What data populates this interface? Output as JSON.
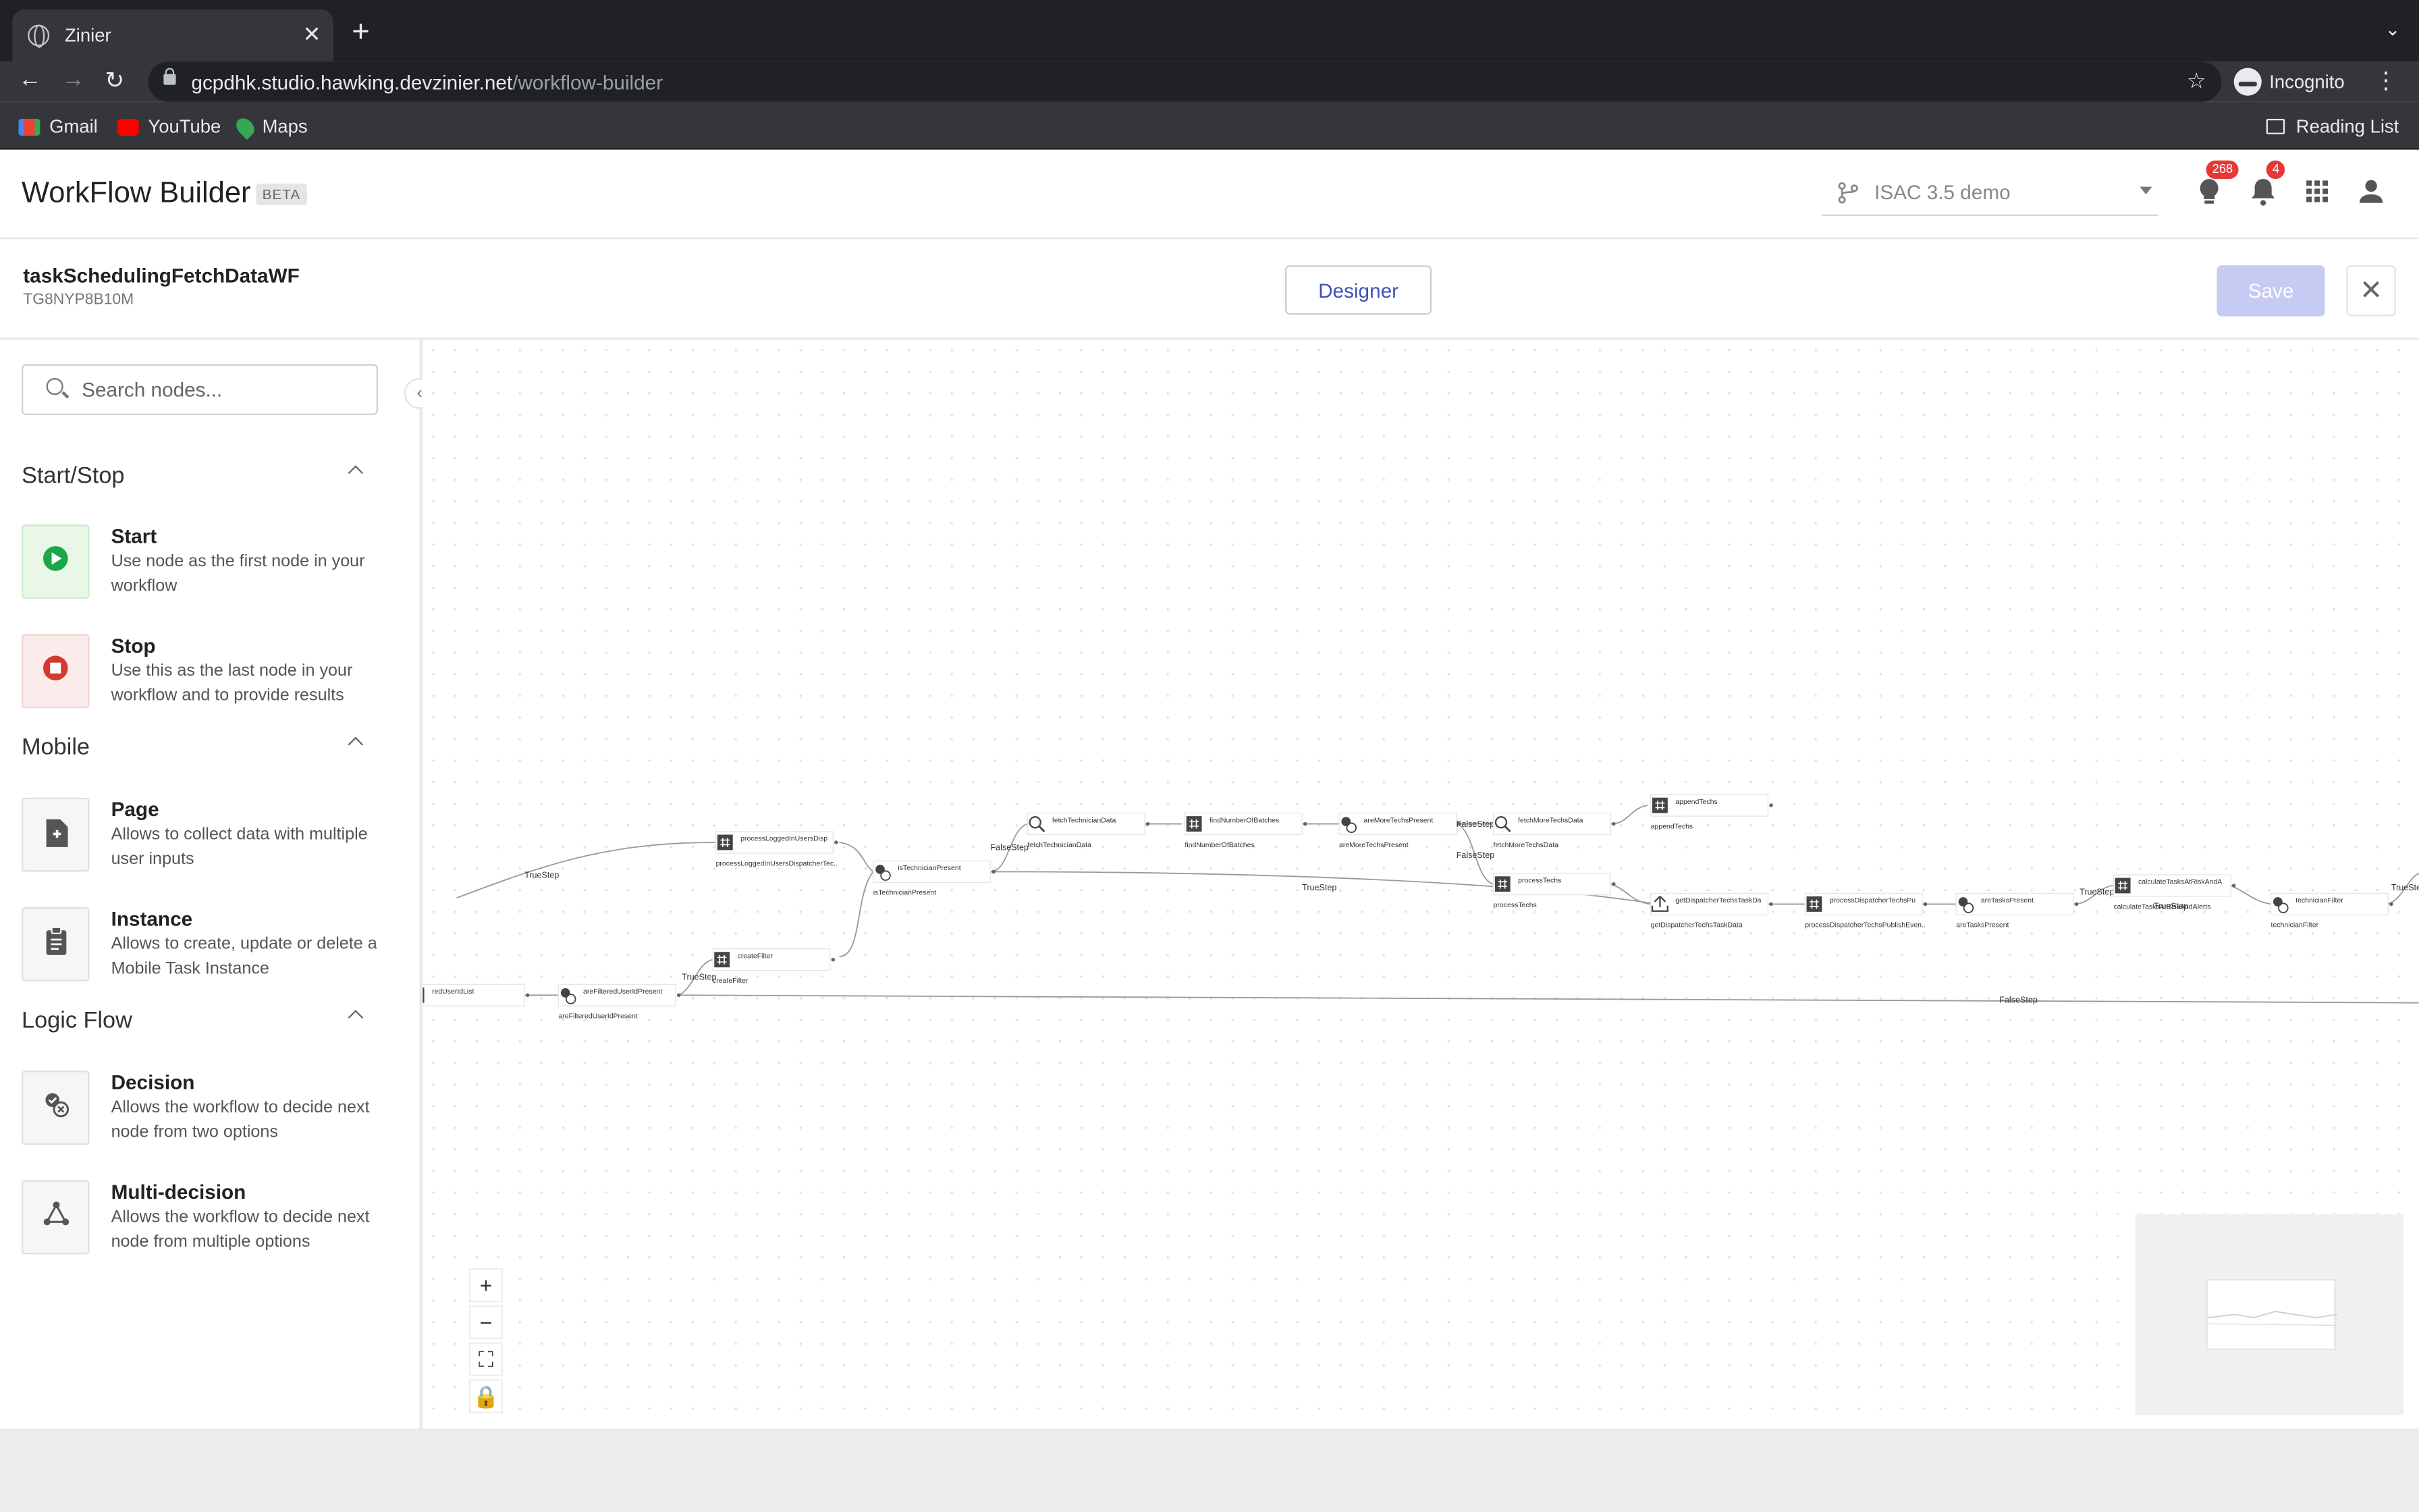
{
  "browser": {
    "tab_title": "Zinier",
    "url_host": "gcpdhk.studio.hawking.devzinier.net",
    "url_path": "/workflow-builder",
    "profile_label": "Incognito",
    "bookmarks": [
      "Gmail",
      "YouTube",
      "Maps"
    ],
    "reading_list_label": "Reading List"
  },
  "header": {
    "app_title": "WorkFlow Builder",
    "beta_label": "BETA",
    "environment": "ISAC 3.5 demo",
    "tips_count": "268",
    "notification_count": "4"
  },
  "workflow": {
    "name": "taskSchedulingFetchDataWF",
    "id": "TG8NYP8B10M",
    "designer_label": "Designer",
    "save_label": "Save"
  },
  "sidebar": {
    "search_placeholder": "Search nodes...",
    "sections": [
      {
        "title": "Start/Stop",
        "items": [
          {
            "name": "Start",
            "description": "Use node as the first node in your workflow",
            "icon": "play-icon"
          },
          {
            "name": "Stop",
            "description": "Use this as the last node in your workflow and to provide results",
            "icon": "stop-icon"
          }
        ]
      },
      {
        "title": "Mobile",
        "items": [
          {
            "name": "Page",
            "description": "Allows to collect data with multiple user inputs",
            "icon": "add-page-icon"
          },
          {
            "name": "Instance",
            "description": "Allows to create, update or delete a Mobile Task Instance",
            "icon": "clipboard-icon"
          }
        ]
      },
      {
        "title": "Logic Flow",
        "items": [
          {
            "name": "Decision",
            "description": "Allows the workflow to decide next node from two options",
            "icon": "decision-icon"
          },
          {
            "name": "Multi-decision",
            "description": "Allows the workflow to decide next node from multiple options",
            "icon": "multi-decision-icon"
          }
        ]
      }
    ]
  },
  "canvas": {
    "nodes": [
      {
        "title": "processLoggedInUsersDispatcherTechs",
        "caption": "processLoggedInUsersDispatcherTec..",
        "icon": "function-icon"
      },
      {
        "title": "isTechnicianPresent",
        "caption": "isTechnicianPresent",
        "icon": "decision-icon"
      },
      {
        "title": "fetchTechnicianData",
        "caption": "fetchTechnicianData",
        "icon": "search-icon"
      },
      {
        "title": "findNumberOfBatches",
        "caption": "findNumberOfBatches",
        "icon": "function-icon"
      },
      {
        "title": "areMoreTechsPresent",
        "caption": "areMoreTechsPresent",
        "icon": "decision-icon"
      },
      {
        "title": "fetchMoreTechsData",
        "caption": "fetchMoreTechsData",
        "icon": "search-icon"
      },
      {
        "title": "appendTechs",
        "caption": "appendTechs",
        "icon": "function-icon"
      },
      {
        "title": "processTechs",
        "caption": "processTechs",
        "icon": "function-icon"
      },
      {
        "title": "getDispatcherTechsTaskData",
        "caption": "getDispatcherTechsTaskData",
        "icon": "upload-icon"
      },
      {
        "title": "processDispatcherTechsPublishEventData",
        "caption": "processDispatcherTechsPublishEven..",
        "icon": "function-icon"
      },
      {
        "title": "areTasksPresent",
        "caption": "areTasksPresent",
        "icon": "decision-icon"
      },
      {
        "title": "calculateTasksAtRiskAndAlerts",
        "caption": "calculateTasksAtRiskAndAlerts",
        "icon": "function-icon"
      },
      {
        "title": "technicianFilter",
        "caption": "technicianFilter",
        "icon": "decision-icon"
      },
      {
        "title": "createFilter",
        "caption": "createFilter",
        "icon": "function-icon"
      },
      {
        "title": "areFilteredUserIdPresent",
        "caption": "areFilteredUserIdPresent",
        "icon": "decision-icon"
      },
      {
        "title": "redUserIdList",
        "caption": "IList",
        "icon": "function-icon"
      }
    ],
    "edge_labels": [
      "TrueStep",
      "FalseStep",
      "TrueStep",
      "FalseStep",
      "FalseStep",
      "TrueStep",
      "TrueStep",
      "TrueStep",
      "FalseStep",
      "TrueStep"
    ]
  }
}
